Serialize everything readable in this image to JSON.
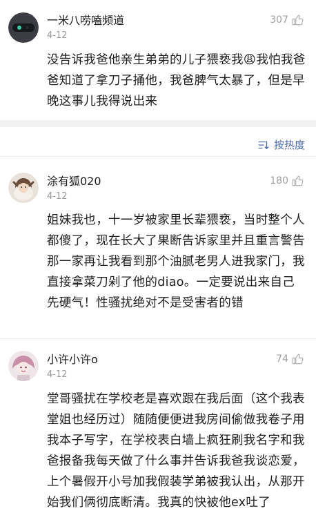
{
  "comments": [
    {
      "username": "一米八唠嗑频道",
      "date": "4-12",
      "likes": "307",
      "text": "没告诉我爸他亲生弟弟的儿子猥亵我😩我怕我爸爸知道了拿刀子捅他，我爸脾气太暴了，但是早晚这事儿我得说出来"
    },
    {
      "username": "涂有狐020",
      "date": "4-12",
      "likes": "180",
      "text": "姐妹我也，十一岁被家里长辈猥亵，当时整个人都傻了，现在长大了果断告诉家里并且重言警告那一家再让我看到那个油腻老男人进我家门，我直接拿菜刀剁了他的diao。一定要说出来自己先硬气！性骚扰绝对不是受害者的错"
    },
    {
      "username": "小许小许o",
      "date": "4-12",
      "likes": "74",
      "text": "堂哥骚扰在学校老是喜欢跟在我后面（这个我表堂姐也经历过）随随便便进我房间偷做我卷子用我本子写字，在学校表白墙上疯狂刷我名字和我爸报备我每天做了什么事并告诉我爸我谈恋爱，上个暑假开小号加我假装学弟被我认出，从那开始我们俩彻底断清。我真的快被他ex吐了"
    }
  ],
  "sort": {
    "label": "按热度",
    "icon": "sort-icon"
  },
  "icons": {
    "like": "thumbs-up-icon"
  },
  "colors": {
    "accent": "#4a6aa8",
    "muted": "#999999",
    "divider": "#f2f2f2"
  }
}
